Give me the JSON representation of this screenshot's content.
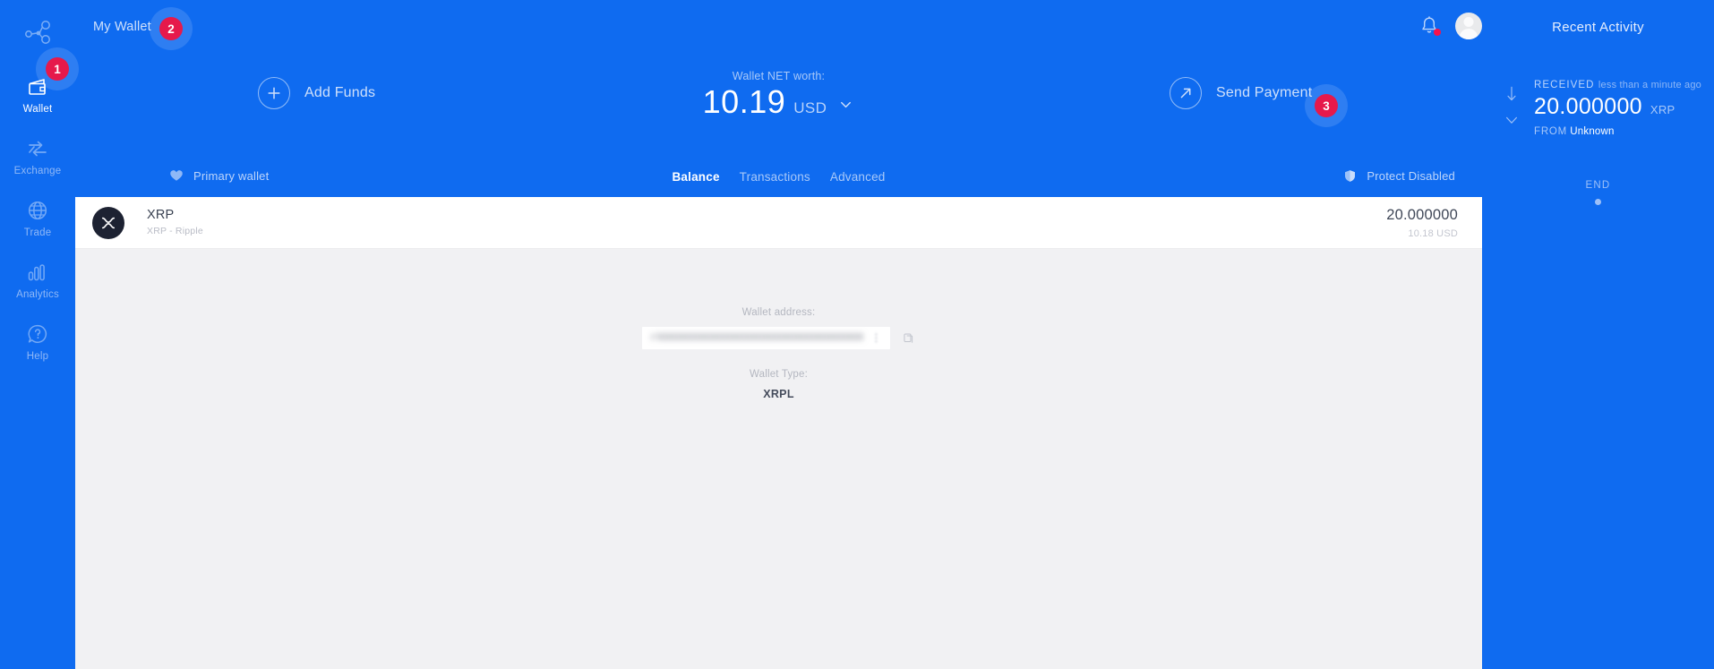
{
  "theme": {
    "brand_blue": "#0f6bf0",
    "badge_red": "#e6194b",
    "page_bg": "#f1f1f3",
    "card_bg": "#ffffff",
    "coin_circle": "#1d2232"
  },
  "sidebar": {
    "logo_icon": "network-nodes-logo",
    "items": [
      {
        "label": "Wallet",
        "icon": "wallet-icon",
        "active": true
      },
      {
        "label": "Exchange",
        "icon": "exchange-icon",
        "active": false
      },
      {
        "label": "Trade",
        "icon": "globe-icon",
        "active": false
      },
      {
        "label": "Analytics",
        "icon": "bar-chart-icon",
        "active": false
      },
      {
        "label": "Help",
        "icon": "question-icon",
        "active": false
      }
    ]
  },
  "step_markers": [
    {
      "number": "1",
      "target": "sidebar-item-wallet"
    },
    {
      "number": "2",
      "target": "my-wallet-menu"
    },
    {
      "number": "3",
      "target": "send-payment-button"
    }
  ],
  "header": {
    "my_wallet_label": "My Wallet",
    "notification_icon": "bell-icon",
    "has_notification_dot": true,
    "avatar_icon": "user-avatar"
  },
  "actions": {
    "add_funds_label": "Add Funds",
    "add_funds_icon": "plus-circle-icon",
    "send_payment_label": "Send Payment",
    "send_payment_icon": "arrow-up-right-circle-icon"
  },
  "net_worth": {
    "caption": "Wallet NET worth:",
    "amount": "10.19",
    "currency": "USD",
    "chevron_icon": "chevron-down-icon"
  },
  "subbar": {
    "primary_wallet_label": "Primary wallet",
    "primary_wallet_icon": "heart-icon",
    "tabs": [
      {
        "label": "Balance",
        "active": true
      },
      {
        "label": "Transactions",
        "active": false
      },
      {
        "label": "Advanced",
        "active": false
      }
    ],
    "protect_label": "Protect Disabled",
    "protect_icon": "shield-icon"
  },
  "asset_row": {
    "coin_icon": "xrp-icon",
    "symbol": "XRP",
    "subtitle": "XRP - Ripple",
    "balance": "20.000000",
    "balance_usd": "10.18 USD"
  },
  "wallet_details": {
    "address_caption": "Wallet address:",
    "address_value": "rXXXXXXXXXXXXXXXXXXXXXXXXXXXXXXXX",
    "address_redacted": true,
    "copy_icon": "copy-icon",
    "type_caption": "Wallet Type:",
    "type_value": "XRPL"
  },
  "recent_activity": {
    "title": "Recent Activity",
    "entries": [
      {
        "direction_icon": "arrow-down-icon",
        "expand_icon": "chevron-down-icon",
        "kind": "RECEIVED",
        "when": "less than a minute ago",
        "amount": "20.000000",
        "currency": "XRP",
        "from_label": "FROM",
        "from_value": "Unknown"
      }
    ],
    "end_label": "END",
    "end_dot_icon": "dot-icon"
  }
}
